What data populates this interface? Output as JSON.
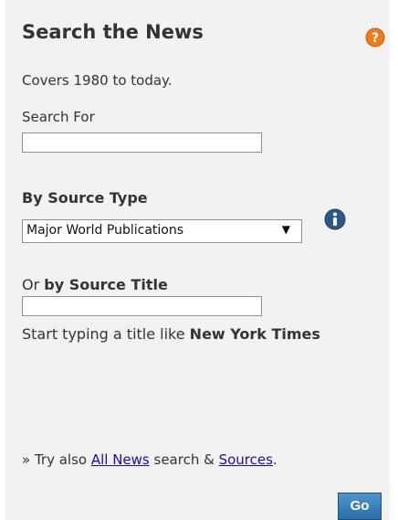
{
  "widget": {
    "title": "Search the News",
    "coverage": "Covers 1980 to today.",
    "search_for_label": "Search For",
    "search_for_value": "",
    "source_type_label": "By Source Type",
    "source_type_selected": "Major World Publications",
    "source_title_prefix": "Or ",
    "source_title_label": "by Source Title",
    "source_title_value": "",
    "hint_prefix": "Start typing a title like ",
    "hint_example": "New York Times",
    "try_prefix": "» Try also ",
    "all_news_link": "All News",
    "try_middle": " search & ",
    "sources_link": "Sources",
    "try_suffix": ".",
    "go_label": "Go"
  },
  "icons": {
    "help": "help-icon",
    "info": "info-icon",
    "dropdown": "dropdown-arrow-icon"
  },
  "colors": {
    "panel_bg": "#f2f2f2",
    "help_icon": "#f07b1a",
    "info_icon": "#2c5a86",
    "link": "#1a0dab",
    "go_button": "#2c6ea8"
  }
}
